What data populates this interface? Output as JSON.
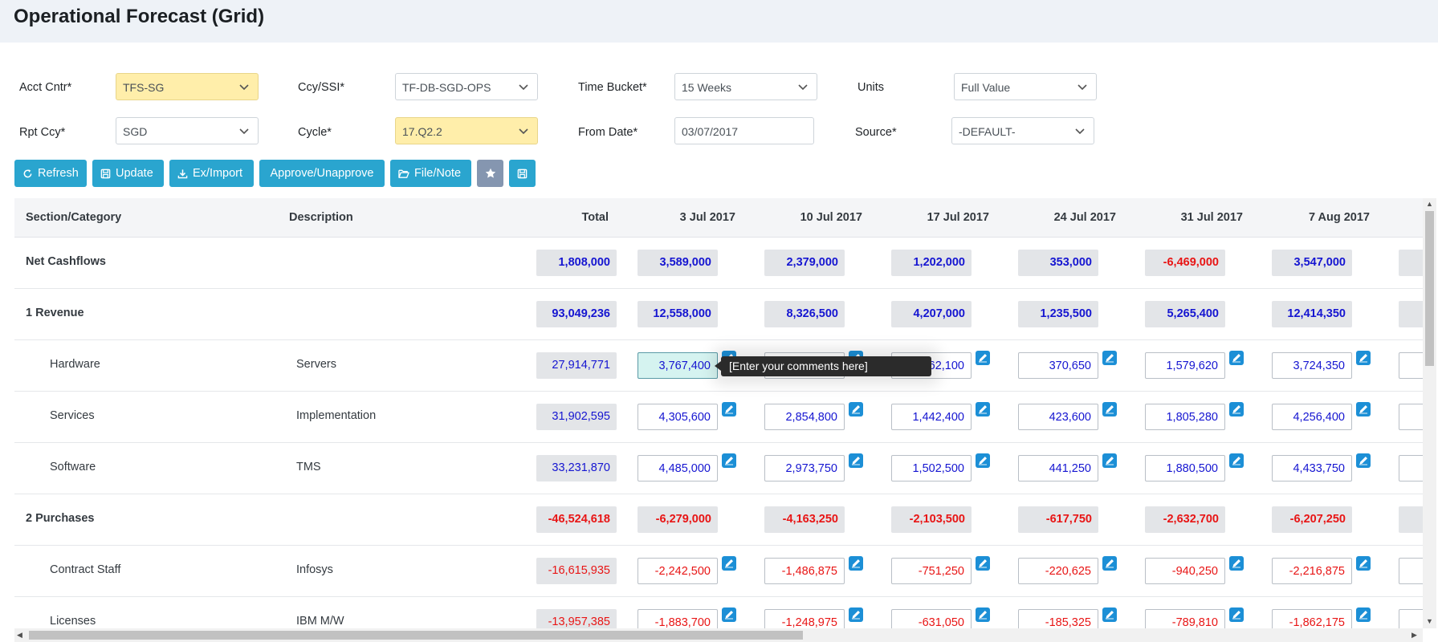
{
  "title": "Operational Forecast (Grid)",
  "filters": {
    "acct_cntr": {
      "label": "Acct Cntr*",
      "value": "TFS-SG"
    },
    "ccy_ssi": {
      "label": "Ccy/SSI*",
      "value": "TF-DB-SGD-OPS"
    },
    "time_bucket": {
      "label": "Time Bucket*",
      "value": "15 Weeks"
    },
    "units": {
      "label": "Units",
      "value": "Full Value"
    },
    "rpt_ccy": {
      "label": "Rpt Ccy*",
      "value": "SGD"
    },
    "cycle": {
      "label": "Cycle*",
      "value": "17.Q2.2"
    },
    "from_date": {
      "label": "From Date*",
      "value": "03/07/2017"
    },
    "source": {
      "label": "Source*",
      "value": "-DEFAULT-"
    }
  },
  "toolbar": {
    "refresh": "Refresh",
    "update": "Update",
    "eximport": "Ex/Import",
    "approve": "Approve/Unapprove",
    "filenote": "File/Note"
  },
  "grid": {
    "headers": {
      "section": "Section/Category",
      "description": "Description",
      "total": "Total",
      "c1": "3 Jul 2017",
      "c2": "10 Jul 2017",
      "c3": "17 Jul 2017",
      "c4": "24 Jul 2017",
      "c5": "31 Jul 2017",
      "c6": "7 Aug 2017"
    },
    "rows": [
      {
        "cat": "Net Cashflows",
        "desc": "",
        "total": "1,808,000",
        "v1": "3,589,000",
        "v2": "2,379,000",
        "v3": "1,202,000",
        "v4": "353,000",
        "v5": "-6,469,000",
        "v6": "3,547,000"
      },
      {
        "cat": "1 Revenue",
        "desc": "",
        "total": "93,049,236",
        "v1": "12,558,000",
        "v2": "8,326,500",
        "v3": "4,207,000",
        "v4": "1,235,500",
        "v5": "5,265,400",
        "v6": "12,414,350"
      },
      {
        "cat": "Hardware",
        "desc": "Servers",
        "total": "27,914,771",
        "v1": "3,767,400",
        "v2": "",
        "v3": "262,100",
        "v4": "370,650",
        "v5": "1,579,620",
        "v6": "3,724,350"
      },
      {
        "cat": "Services",
        "desc": "Implementation",
        "total": "31,902,595",
        "v1": "4,305,600",
        "v2": "2,854,800",
        "v3": "1,442,400",
        "v4": "423,600",
        "v5": "1,805,280",
        "v6": "4,256,400"
      },
      {
        "cat": "Software",
        "desc": "TMS",
        "total": "33,231,870",
        "v1": "4,485,000",
        "v2": "2,973,750",
        "v3": "1,502,500",
        "v4": "441,250",
        "v5": "1,880,500",
        "v6": "4,433,750"
      },
      {
        "cat": "2 Purchases",
        "desc": "",
        "total": "-46,524,618",
        "v1": "-6,279,000",
        "v2": "-4,163,250",
        "v3": "-2,103,500",
        "v4": "-617,750",
        "v5": "-2,632,700",
        "v6": "-6,207,250"
      },
      {
        "cat": "Contract Staff",
        "desc": "Infosys",
        "total": "-16,615,935",
        "v1": "-2,242,500",
        "v2": "-1,486,875",
        "v3": "-751,250",
        "v4": "-220,625",
        "v5": "-940,250",
        "v6": "-2,216,875"
      },
      {
        "cat": "Licenses",
        "desc": "IBM M/W",
        "total": "-13,957,385",
        "v1": "-1,883,700",
        "v2": "-1,248,975",
        "v3": "-631,050",
        "v4": "-185,325",
        "v5": "-789,810",
        "v6": "-1,862,175"
      }
    ]
  },
  "tooltip": "[Enter your comments here]",
  "colors": {
    "accent": "#2aa5cf",
    "positive": "#1515d1",
    "negative": "#e81515",
    "highlight": "#ffeeaa"
  }
}
